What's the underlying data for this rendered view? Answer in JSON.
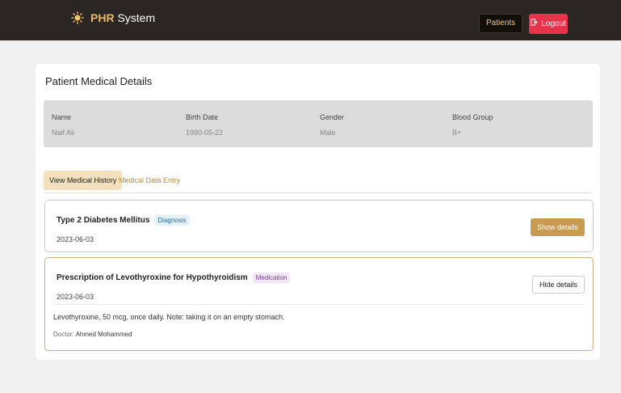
{
  "header": {
    "brand_accent": "PHR",
    "brand_rest": "System",
    "patients_label": "Patients",
    "logout_label": "Logout",
    "icons": {
      "brand": "sun-icon",
      "logout": "logout-icon"
    },
    "colors": {
      "topbar": "#2b2623",
      "brand_accent": "#e7b764",
      "logout": "#e8344a"
    }
  },
  "page": {
    "title": "Patient Medical Details"
  },
  "patient": {
    "name_label": "Name",
    "name": "Naif Ali",
    "birth_label": "Birth Date",
    "birth_date": "1980-05-22",
    "gender_label": "Gender",
    "gender": "Male",
    "blood_label": "Blood Group",
    "blood_group": "B+"
  },
  "tabs": [
    {
      "label": "View Medical History",
      "active": true
    },
    {
      "label": "Medical Data Entry",
      "active": false
    }
  ],
  "records": [
    {
      "title": "Type 2 Diabetes Mellitus",
      "type": "Diagnosis",
      "date": "2023-06-03",
      "button": "Show details",
      "expanded": false
    },
    {
      "title": "Prescription of Levothyroxine for Hypothyroidism",
      "type": "Medication",
      "date": "2023-06-03",
      "button": "Hide details",
      "expanded": true,
      "notes": "Levothyroxine, 50 mcg, once daily. Note: taking it on an empty stomach.",
      "doctor_label": "Doctor:",
      "doctor": "Ahmed Mohammed"
    }
  ]
}
